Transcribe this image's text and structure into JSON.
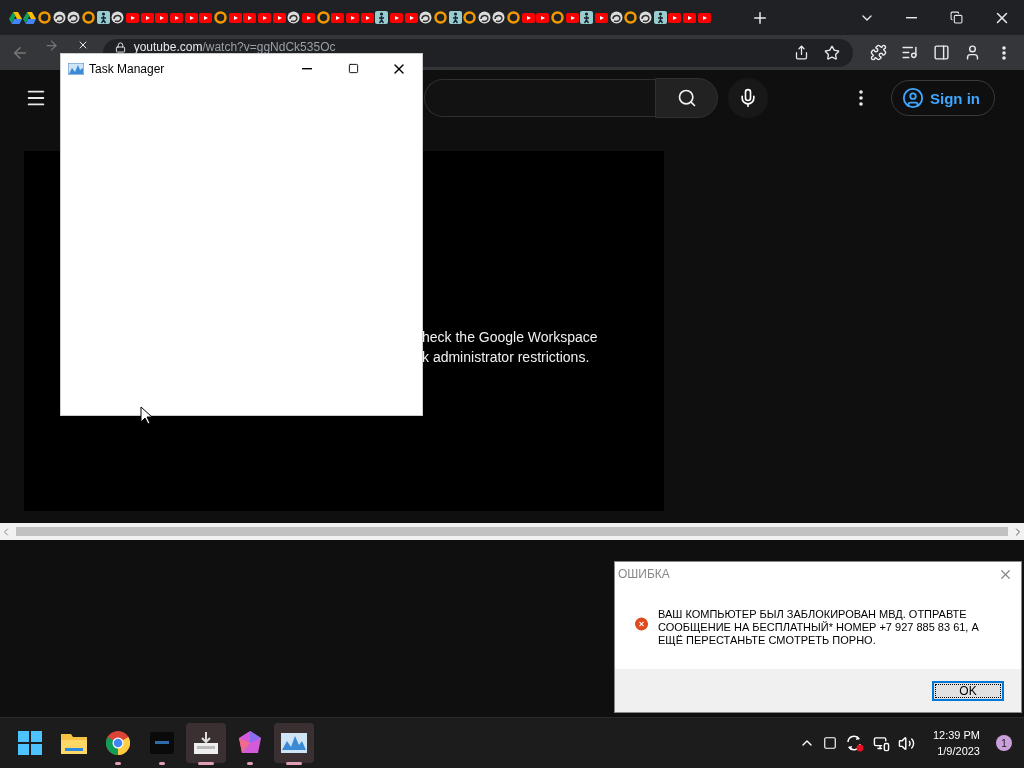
{
  "browser": {
    "tabs": [
      {
        "kind": "drive"
      },
      {
        "kind": "drive"
      },
      {
        "kind": "ring"
      },
      {
        "kind": "swirl"
      },
      {
        "kind": "swirl"
      },
      {
        "kind": "ring"
      },
      {
        "kind": "figure"
      },
      {
        "kind": "swirl"
      },
      {
        "kind": "video"
      },
      {
        "kind": "video"
      },
      {
        "kind": "video"
      },
      {
        "kind": "video"
      },
      {
        "kind": "video"
      },
      {
        "kind": "video"
      },
      {
        "kind": "ring"
      },
      {
        "kind": "video"
      },
      {
        "kind": "video"
      },
      {
        "kind": "video"
      },
      {
        "kind": "video"
      },
      {
        "kind": "swirl"
      },
      {
        "kind": "video"
      },
      {
        "kind": "ring"
      },
      {
        "kind": "video"
      },
      {
        "kind": "video"
      },
      {
        "kind": "video"
      },
      {
        "kind": "figure"
      },
      {
        "kind": "video"
      },
      {
        "kind": "video"
      },
      {
        "kind": "swirl"
      },
      {
        "kind": "ring"
      },
      {
        "kind": "figure"
      },
      {
        "kind": "ring"
      },
      {
        "kind": "swirl"
      },
      {
        "kind": "swirl"
      },
      {
        "kind": "ring"
      },
      {
        "kind": "video"
      },
      {
        "kind": "video"
      },
      {
        "kind": "ring"
      },
      {
        "kind": "video"
      },
      {
        "kind": "figure"
      },
      {
        "kind": "video"
      },
      {
        "kind": "swirl"
      },
      {
        "kind": "ring"
      },
      {
        "kind": "swirl"
      },
      {
        "kind": "figure"
      },
      {
        "kind": "video"
      },
      {
        "kind": "video"
      },
      {
        "kind": "video"
      }
    ],
    "url_domain": "youtube.com",
    "url_path": "/watch?v=ggNdCk535Oc"
  },
  "youtube": {
    "sign_in": "Sign in",
    "player_message": [
      "heck the Google Workspace",
      "k administrator restrictions."
    ]
  },
  "task_manager": {
    "title": "Task Manager"
  },
  "dialog": {
    "title": "ОШИБКА",
    "message": "ВАШ КОМПЬЮТЕР БЫЛ ЗАБЛОКИРОВАН МВД. ОТПРАВТЕ СООБЩЕНИЕ НА БЕСПЛАТНЫЙ* НОМЕР +7 927 885 83 61, А ЕЩЁ ПЕРЕСТАНЬТЕ СМОТРЕТЬ ПОРНО.",
    "button": "OK"
  },
  "taskbar": {
    "apps": [
      {
        "kind": "start",
        "active": false,
        "running": false
      },
      {
        "kind": "folder",
        "active": false,
        "running": false
      },
      {
        "kind": "chrome",
        "active": false,
        "running": true
      },
      {
        "kind": "terminal",
        "active": false,
        "running": true
      },
      {
        "kind": "installer",
        "active": true,
        "running": true
      },
      {
        "kind": "gem",
        "active": false,
        "running": true
      },
      {
        "kind": "monitor",
        "active": true,
        "running": true
      }
    ],
    "time": "12:39 PM",
    "date": "1/9/2023",
    "badge": "1"
  }
}
